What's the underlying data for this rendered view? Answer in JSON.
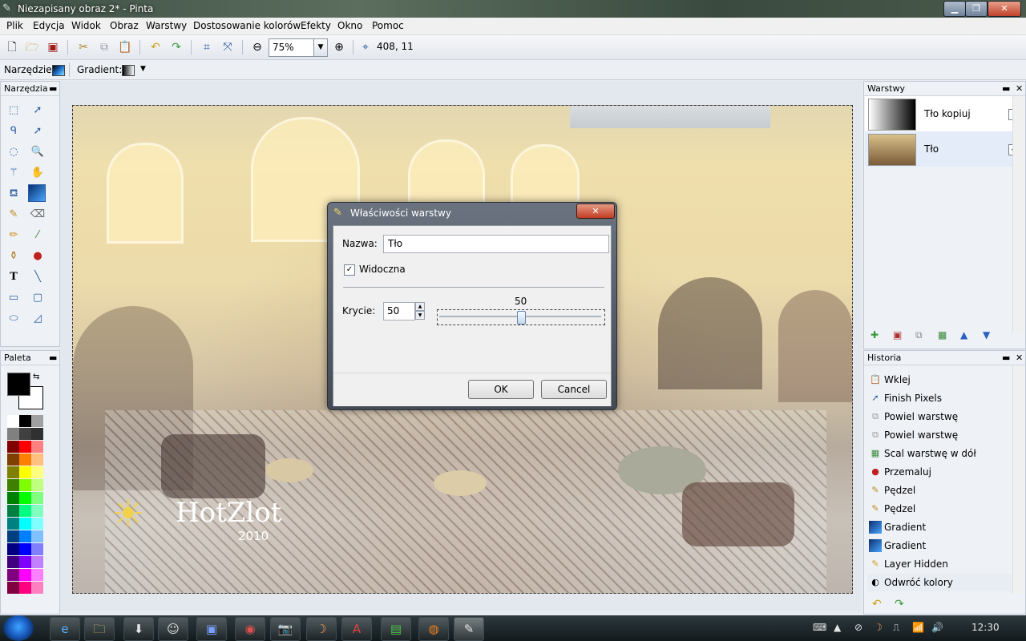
{
  "window": {
    "title": "Niezapisany obraz 2* - Pinta"
  },
  "menu": [
    "Plik",
    "Edycja",
    "Widok",
    "Obraz",
    "Warstwy",
    "Dostosowanie kolorów",
    "Efekty",
    "Okno",
    "Pomoc"
  ],
  "toolbar": {
    "zoom_value": "75%",
    "cursor_pos": "408, 11"
  },
  "options": {
    "tool_label": "Narzędzie:",
    "gradient_label": "Gradient:"
  },
  "panels": {
    "tools_title": "Narzędzia",
    "palette_title": "Paleta",
    "layers_title": "Warstwy",
    "history_title": "Historia"
  },
  "layers": [
    {
      "name": "Tło kopiuj",
      "visible": false
    },
    {
      "name": "Tło",
      "visible": true
    }
  ],
  "history": [
    "Wklej",
    "Finish Pixels",
    "Powiel warstwę",
    "Powiel warstwę",
    "Scal warstwę w dół",
    "Przemaluj",
    "Pędzel",
    "Pędzel",
    "Gradient",
    "Gradient",
    "Layer Hidden",
    "Odwróć kolory"
  ],
  "image": {
    "watermark": "HotZlot",
    "watermark_year": "2010"
  },
  "dialog": {
    "title": "Właściwości warstwy",
    "name_label": "Nazwa:",
    "name_value": "Tło",
    "visible_label": "Widoczna",
    "opacity_label": "Krycie:",
    "opacity_value": "50",
    "slider_value": "50",
    "ok_label": "OK",
    "cancel_label": "Cancel"
  },
  "taskbar": {
    "clock": "12:30"
  },
  "colors": {
    "accent": "#1a5ec2",
    "close": "#c23c23"
  }
}
